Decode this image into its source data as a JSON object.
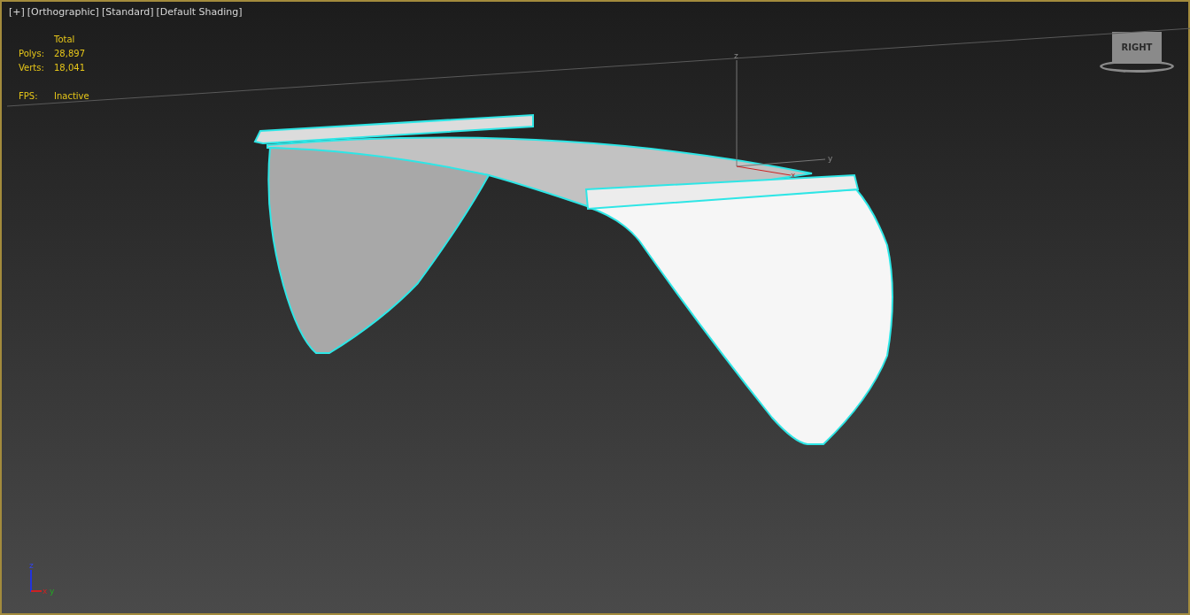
{
  "viewport": {
    "labels": [
      "[+]",
      "[Orthographic]",
      "[Standard]",
      "[Default Shading]"
    ],
    "active": true
  },
  "statistics": {
    "column": "Total",
    "rows": [
      {
        "label": "Polys:",
        "value": "28,897"
      },
      {
        "label": "Verts:",
        "value": "18,041"
      }
    ],
    "fps": {
      "label": "FPS:",
      "value": "Inactive"
    }
  },
  "object_gizmo": {
    "z": "z",
    "y": "y",
    "x": "x"
  },
  "view_cube": {
    "face": "RIGHT"
  },
  "world_axis": {
    "z": "z",
    "x": "x",
    "y": "y"
  }
}
